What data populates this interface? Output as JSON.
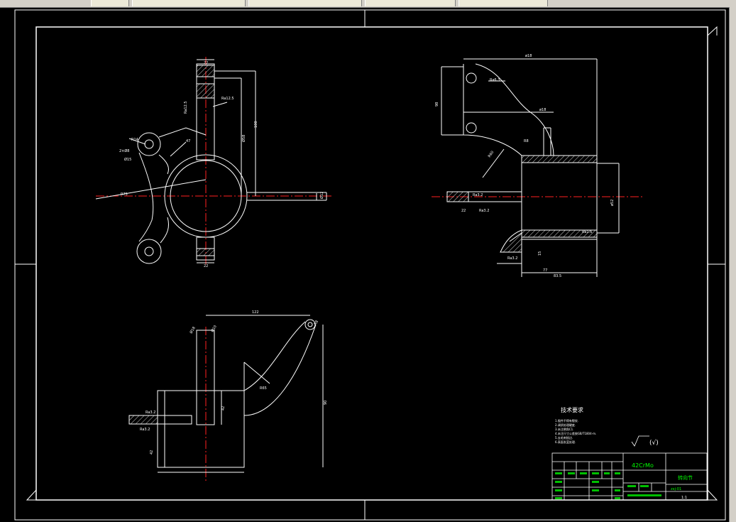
{
  "toolbar": {
    "tabs": [
      {
        "label": ""
      },
      {
        "label": ""
      },
      {
        "label": ""
      },
      {
        "label": ""
      },
      {
        "label": ""
      }
    ]
  },
  "drawing": {
    "tech_requirements_title": "技术要求",
    "tech_requirements_lines": [
      "1.锻件不得有裂纹.",
      "2.调质处理硬度.",
      "3.未注倒角C1.",
      "4.未注尺寸公差按GB/T1804-m.",
      "5.去毛刺锐边.",
      "6.表面发蓝处理."
    ],
    "surface_finish_note": "(√)",
    "material": "42CrMo",
    "part_name": "转向节",
    "drawing_number": "zxj-01",
    "scale_note": "1:1",
    "colors": {
      "line": "#ffffff",
      "centerline": "#ff2020",
      "dimension": "#ffffff",
      "highlight": "#00ff00",
      "background": "#000000"
    }
  }
}
